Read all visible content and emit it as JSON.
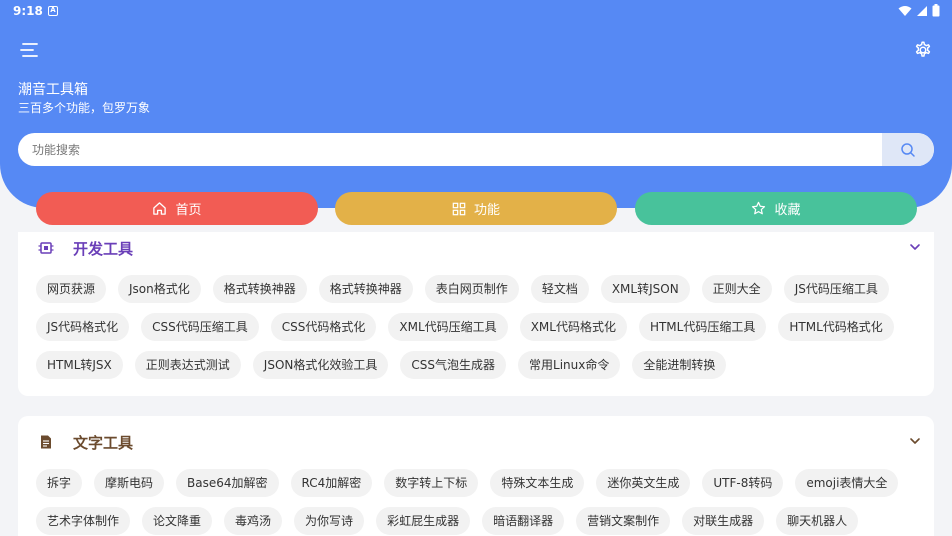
{
  "status_bar": {
    "time": "9:18",
    "notification_icon": "A"
  },
  "app": {
    "title": "潮音工具箱",
    "subtitle": "三百多个功能，包罗万象"
  },
  "search": {
    "placeholder": "功能搜索",
    "value": ""
  },
  "nav": {
    "home": "首页",
    "functions": "功能",
    "favorites": "收藏"
  },
  "colors": {
    "header": "#5689f4",
    "home": "#f25c54",
    "functions": "#e3b148",
    "favorites": "#48c29b",
    "dev_title": "#6a3fb8",
    "text_title": "#6b4b2e"
  },
  "sections": [
    {
      "title": "开发工具",
      "icon": "chip-icon",
      "items": [
        "网页获源",
        "Json格式化",
        "格式转换神器",
        "格式转换神器",
        "表白网页制作",
        "轻文档",
        "XML转JSON",
        "正则大全",
        "JS代码压缩工具",
        "JS代码格式化",
        "CSS代码压缩工具",
        "CSS代码格式化",
        "XML代码压缩工具",
        "XML代码格式化",
        "HTML代码压缩工具",
        "HTML代码格式化",
        "HTML转JSX",
        "正则表达式测试",
        "JSON格式化效验工具",
        "CSS气泡生成器",
        "常用Linux命令",
        "全能进制转换"
      ]
    },
    {
      "title": "文字工具",
      "icon": "document-icon",
      "items": [
        "拆字",
        "摩斯电码",
        "Base64加解密",
        "RC4加解密",
        "数字转上下标",
        "特殊文本生成",
        "迷你英文生成",
        "UTF-8转码",
        "emoji表情大全",
        "艺术字体制作",
        "论文降重",
        "毒鸡汤",
        "为你写诗",
        "彩虹屁生成器",
        "暗语翻译器",
        "营销文案制作",
        "对联生成器",
        "聊天机器人"
      ]
    }
  ]
}
